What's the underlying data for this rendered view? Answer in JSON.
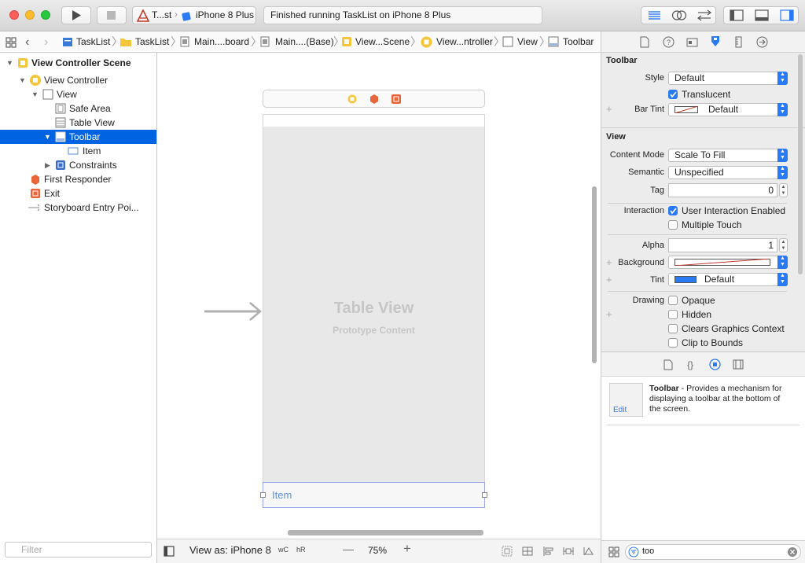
{
  "toolbar": {
    "scheme_target": "T...st",
    "scheme_device": "iPhone 8 Plus",
    "status": "Finished running TaskList on iPhone 8 Plus"
  },
  "breadcrumbs": [
    {
      "label": "TaskList",
      "icon": "project-icon"
    },
    {
      "label": "TaskList",
      "icon": "folder-icon"
    },
    {
      "label": "Main....board",
      "icon": "storyboard-icon"
    },
    {
      "label": "Main....(Base)",
      "icon": "storyboard-icon"
    },
    {
      "label": "View...Scene",
      "icon": "scene-icon"
    },
    {
      "label": "View...ntroller",
      "icon": "view-controller-icon"
    },
    {
      "label": "View",
      "icon": "view-icon"
    },
    {
      "label": "Toolbar",
      "icon": "toolbar-icon"
    }
  ],
  "outline": {
    "scene": "View Controller Scene",
    "items": [
      {
        "label": "View Controller"
      },
      {
        "label": "View"
      },
      {
        "label": "Safe Area"
      },
      {
        "label": "Table View"
      },
      {
        "label": "Toolbar"
      },
      {
        "label": "Item"
      },
      {
        "label": "Constraints"
      },
      {
        "label": "First Responder"
      },
      {
        "label": "Exit"
      },
      {
        "label": "Storyboard Entry Poi..."
      }
    ],
    "filter_placeholder": "Filter"
  },
  "canvas": {
    "table_title": "Table View",
    "table_subtitle": "Prototype Content",
    "toolbar_item": "Item",
    "view_as": "View as: iPhone 8",
    "size_class_w": "wC",
    "size_class_h": "hR",
    "zoom_minus": "—",
    "zoom": "75%",
    "zoom_plus": "+"
  },
  "inspector": {
    "toolbar_section": "Toolbar",
    "style_label": "Style",
    "style_value": "Default",
    "translucent_label": "Translucent",
    "translucent": true,
    "bar_tint_label": "Bar Tint",
    "bar_tint_value": "Default",
    "view_section": "View",
    "content_mode_label": "Content Mode",
    "content_mode_value": "Scale To Fill",
    "semantic_label": "Semantic",
    "semantic_value": "Unspecified",
    "tag_label": "Tag",
    "tag_value": "0",
    "interaction_label": "Interaction",
    "user_interaction_label": "User Interaction Enabled",
    "user_interaction": true,
    "multiple_touch_label": "Multiple Touch",
    "multiple_touch": false,
    "alpha_label": "Alpha",
    "alpha_value": "1",
    "background_label": "Background",
    "tint_label": "Tint",
    "tint_value": "Default",
    "tint_color": "#2a7af5",
    "drawing_label": "Drawing",
    "opaque_label": "Opaque",
    "hidden_label": "Hidden",
    "clears_label": "Clears Graphics Context",
    "clip_label": "Clip to Bounds"
  },
  "library": {
    "item_name": "Toolbar",
    "item_description": " - Provides a mechanism for displaying a toolbar at the bottom of the screen.",
    "edit_label": "Edit",
    "search_value": "too"
  },
  "colors": {
    "accent": "#0063e1",
    "selection": "#0063e1",
    "control_blue": "#2a7af5"
  }
}
